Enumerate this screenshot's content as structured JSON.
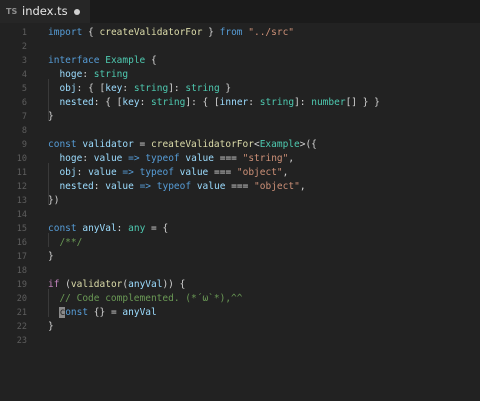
{
  "tab": {
    "lang_badge": "TS",
    "filename": "index.ts"
  },
  "lines": [
    {
      "n": "1",
      "tokens": [
        [
          "kw",
          "import"
        ],
        [
          "op",
          " { "
        ],
        [
          "fn",
          "createValidatorFor"
        ],
        [
          "op",
          " } "
        ],
        [
          "kw",
          "from"
        ],
        [
          "op",
          " "
        ],
        [
          "str",
          "\"../src\""
        ]
      ]
    },
    {
      "n": "2",
      "tokens": []
    },
    {
      "n": "3",
      "tokens": [
        [
          "kw",
          "interface"
        ],
        [
          "op",
          " "
        ],
        [
          "ty",
          "Example"
        ],
        [
          "op",
          " {"
        ]
      ]
    },
    {
      "n": "4",
      "tokens": [
        [
          "op",
          "  "
        ],
        [
          "var",
          "hoge"
        ],
        [
          "op",
          ": "
        ],
        [
          "ty",
          "string"
        ]
      ]
    },
    {
      "n": "5",
      "tokens": [
        [
          "op",
          "  "
        ],
        [
          "var",
          "obj"
        ],
        [
          "op",
          ": { ["
        ],
        [
          "var",
          "key"
        ],
        [
          "op",
          ": "
        ],
        [
          "ty",
          "string"
        ],
        [
          "op",
          "]: "
        ],
        [
          "ty",
          "string"
        ],
        [
          "op",
          " }"
        ]
      ]
    },
    {
      "n": "6",
      "tokens": [
        [
          "op",
          "  "
        ],
        [
          "var",
          "nested"
        ],
        [
          "op",
          ": { ["
        ],
        [
          "var",
          "key"
        ],
        [
          "op",
          ": "
        ],
        [
          "ty",
          "string"
        ],
        [
          "op",
          "]: { ["
        ],
        [
          "var",
          "inner"
        ],
        [
          "op",
          ": "
        ],
        [
          "ty",
          "string"
        ],
        [
          "op",
          "]: "
        ],
        [
          "ty",
          "number"
        ],
        [
          "op",
          "[] } }"
        ]
      ]
    },
    {
      "n": "7",
      "tokens": [
        [
          "op",
          "}"
        ]
      ]
    },
    {
      "n": "8",
      "tokens": []
    },
    {
      "n": "9",
      "tokens": [
        [
          "kw",
          "const"
        ],
        [
          "op",
          " "
        ],
        [
          "var",
          "validator"
        ],
        [
          "op",
          " = "
        ],
        [
          "fn",
          "createValidatorFor"
        ],
        [
          "op",
          "<"
        ],
        [
          "ty",
          "Example"
        ],
        [
          "op",
          ">({"
        ]
      ]
    },
    {
      "n": "10",
      "tokens": [
        [
          "op",
          "  "
        ],
        [
          "var",
          "hoge"
        ],
        [
          "op",
          ": "
        ],
        [
          "var",
          "value"
        ],
        [
          "op",
          " "
        ],
        [
          "kw",
          "=>"
        ],
        [
          "op",
          " "
        ],
        [
          "kw",
          "typeof"
        ],
        [
          "op",
          " "
        ],
        [
          "var",
          "value"
        ],
        [
          "op",
          " === "
        ],
        [
          "str",
          "\"string\""
        ],
        [
          "op",
          ","
        ]
      ]
    },
    {
      "n": "11",
      "tokens": [
        [
          "op",
          "  "
        ],
        [
          "var",
          "obj"
        ],
        [
          "op",
          ": "
        ],
        [
          "var",
          "value"
        ],
        [
          "op",
          " "
        ],
        [
          "kw",
          "=>"
        ],
        [
          "op",
          " "
        ],
        [
          "kw",
          "typeof"
        ],
        [
          "op",
          " "
        ],
        [
          "var",
          "value"
        ],
        [
          "op",
          " === "
        ],
        [
          "str",
          "\"object\""
        ],
        [
          "op",
          ","
        ]
      ]
    },
    {
      "n": "12",
      "tokens": [
        [
          "op",
          "  "
        ],
        [
          "var",
          "nested"
        ],
        [
          "op",
          ": "
        ],
        [
          "var",
          "value"
        ],
        [
          "op",
          " "
        ],
        [
          "kw",
          "=>"
        ],
        [
          "op",
          " "
        ],
        [
          "kw",
          "typeof"
        ],
        [
          "op",
          " "
        ],
        [
          "var",
          "value"
        ],
        [
          "op",
          " === "
        ],
        [
          "str",
          "\"object\""
        ],
        [
          "op",
          ","
        ]
      ]
    },
    {
      "n": "13",
      "tokens": [
        [
          "op",
          "})"
        ]
      ]
    },
    {
      "n": "14",
      "tokens": []
    },
    {
      "n": "15",
      "tokens": [
        [
          "kw",
          "const"
        ],
        [
          "op",
          " "
        ],
        [
          "var",
          "anyVal"
        ],
        [
          "op",
          ": "
        ],
        [
          "ty",
          "any"
        ],
        [
          "op",
          " = {"
        ]
      ]
    },
    {
      "n": "16",
      "tokens": [
        [
          "op",
          "  "
        ],
        [
          "cmt",
          "/**/"
        ]
      ]
    },
    {
      "n": "17",
      "tokens": [
        [
          "op",
          "}"
        ]
      ]
    },
    {
      "n": "18",
      "tokens": []
    },
    {
      "n": "19",
      "tokens": [
        [
          "ctl",
          "if"
        ],
        [
          "op",
          " ("
        ],
        [
          "fn",
          "validator"
        ],
        [
          "op",
          "("
        ],
        [
          "var",
          "anyVal"
        ],
        [
          "op",
          ")) {"
        ]
      ]
    },
    {
      "n": "20",
      "tokens": [
        [
          "op",
          "  "
        ],
        [
          "cmt",
          "// Code complemented. (*´ω`*),^^"
        ]
      ]
    },
    {
      "n": "21",
      "tokens": [
        [
          "op",
          "  "
        ],
        [
          "cur",
          "c"
        ],
        [
          "kw",
          "onst"
        ],
        [
          "op",
          " {} = "
        ],
        [
          "var",
          "anyVal"
        ]
      ]
    },
    {
      "n": "22",
      "tokens": [
        [
          "op",
          "}"
        ]
      ]
    },
    {
      "n": "23",
      "tokens": []
    }
  ]
}
